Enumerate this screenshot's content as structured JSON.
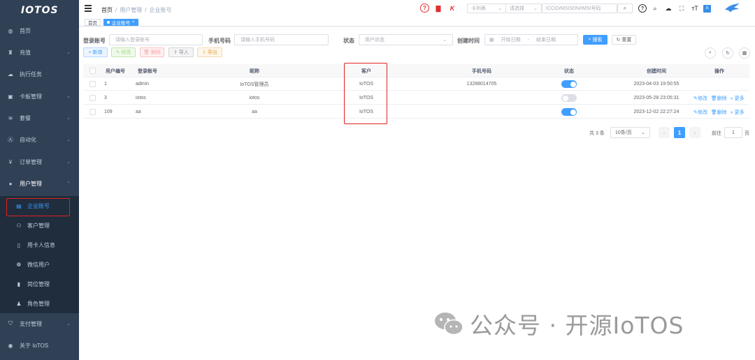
{
  "sidebar": {
    "logo": "IOTOS",
    "menu": [
      {
        "label": "首页",
        "icon": "dashboard-icon",
        "glyph": "◍",
        "arrow": ""
      },
      {
        "label": "充值",
        "icon": "cart-icon",
        "glyph": "♜",
        "arrow": "⌄"
      },
      {
        "label": "执行任务",
        "icon": "cloud-icon",
        "glyph": "☁",
        "arrow": ""
      },
      {
        "label": "卡板管理",
        "icon": "card-icon",
        "glyph": "▣",
        "arrow": "⌄"
      },
      {
        "label": "套餐",
        "icon": "layers-icon",
        "glyph": "≋",
        "arrow": "⌄"
      },
      {
        "label": "自动化",
        "icon": "automation-icon",
        "glyph": "Ⓐ",
        "arrow": "⌄"
      },
      {
        "label": "订单管理",
        "icon": "yen-icon",
        "glyph": "¥",
        "arrow": "⌄"
      },
      {
        "label": "用户管理",
        "icon": "user-icon",
        "glyph": "●",
        "arrow": "⌃"
      }
    ],
    "submenu": [
      {
        "label": "企业账号",
        "icon": "document-icon",
        "glyph": "▤"
      },
      {
        "label": "客户管理",
        "icon": "org-tree-icon",
        "glyph": "⚇"
      },
      {
        "label": "用卡人信息",
        "icon": "phone-icon",
        "glyph": "▯"
      },
      {
        "label": "微信用户",
        "icon": "wechat-icon",
        "glyph": "❁"
      },
      {
        "label": "岗位管理",
        "icon": "post-icon",
        "glyph": "▮"
      },
      {
        "label": "角色管理",
        "icon": "role-icon",
        "glyph": "♟"
      }
    ],
    "bottom_menu": [
      {
        "label": "支付管理",
        "icon": "shield-icon",
        "glyph": "⛉",
        "arrow": "⌄"
      },
      {
        "label": "关于 IoTOS",
        "icon": "info-icon",
        "glyph": "◉",
        "arrow": ""
      }
    ]
  },
  "navbar": {
    "breadcrumb": [
      "首页",
      "用户管理",
      "企业账号"
    ],
    "select_card_type": "卡列表",
    "select_option": "请选择",
    "iccid_placeholder": "ICCID/MSISDN/IMSI号码",
    "search_glyph": "⌕",
    "help_glyph": "?",
    "pdf_glyph": "▇",
    "k_glyph": "K"
  },
  "tags": [
    {
      "label": "首页",
      "active": false
    },
    {
      "label": "企业账号",
      "active": true,
      "close": "×"
    }
  ],
  "filters": {
    "login_label": "登录账号",
    "login_placeholder": "请输入登录账号",
    "phone_label": "手机号码",
    "phone_placeholder": "请输入手机号码",
    "status_label": "状态",
    "status_placeholder": "用户状态",
    "created_label": "创建时间",
    "start_placeholder": "开始日期",
    "range_sep": "-",
    "end_placeholder": "结束日期",
    "search_btn": "搜索",
    "reset_btn": "重置"
  },
  "toolbar": {
    "add": "+ 新增",
    "edit": "✎ 修改",
    "delete": "🗑 删除",
    "import": "⇪ 导入",
    "export": "⇩ 导出"
  },
  "table": {
    "headers": [
      "用户编号",
      "登录账号",
      "昵称",
      "客户",
      "手机号码",
      "状态",
      "创建时间",
      "操作"
    ],
    "rows": [
      {
        "id": "1",
        "login": "admin",
        "nickname": "IoTOS管理员",
        "customer": "IoTOS",
        "phone": "13288014705",
        "status_on": true,
        "created": "2023-04-03 19:50:55",
        "ops": false
      },
      {
        "id": "3",
        "login": "iotos",
        "nickname": "iotos",
        "customer": "IoTOS",
        "phone": "",
        "status_on": false,
        "created": "2023-05-28 23:05:31",
        "ops": true
      },
      {
        "id": "109",
        "login": "aa",
        "nickname": "aa",
        "customer": "IoTOS",
        "phone": "",
        "status_on": true,
        "created": "2023-12-02 22:27:24",
        "ops": true
      }
    ],
    "op_edit": "✎修改",
    "op_delete": "🗑删除",
    "op_more": "» 更多"
  },
  "pagination": {
    "total": "共 3 条",
    "page_size": "10条/页",
    "current": "1",
    "goto_label": "前往",
    "goto_value": "1",
    "page_suffix": "页"
  },
  "watermark": "公众号 · 开源IoTOS",
  "colors": {
    "sidebar": "#304156",
    "primary": "#409eff",
    "highlight": "#e02020"
  }
}
